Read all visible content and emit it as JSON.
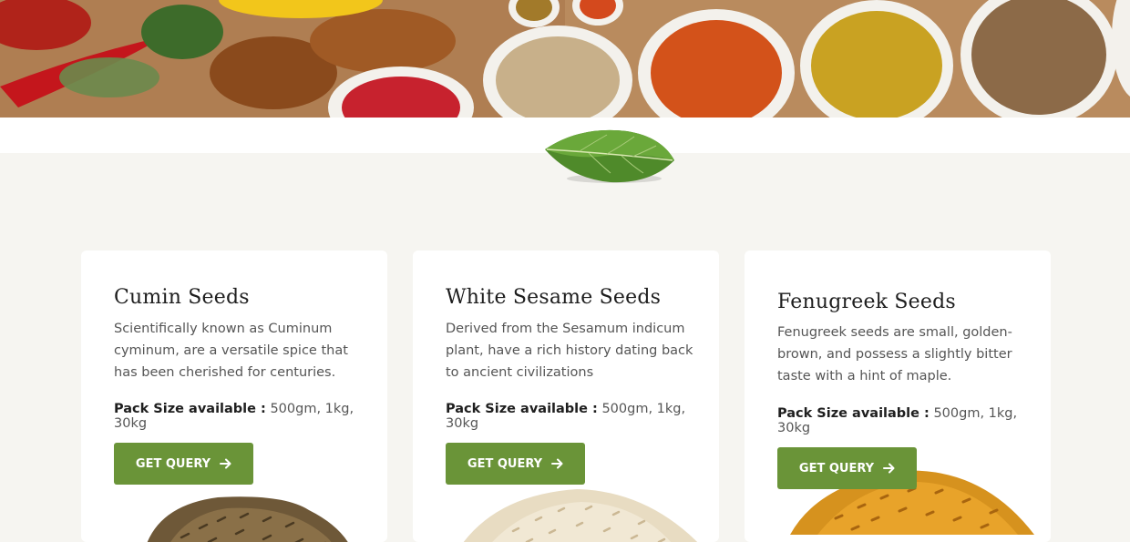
{
  "products": [
    {
      "title": "Cumin Seeds",
      "description": "Scientifically known as Cuminum cyminum, are a versatile spice that has been cherished for centuries.",
      "pack_label": "Pack Size available :",
      "pack_value": "500gm, 1kg, 30kg",
      "button_label": "GET QUERY"
    },
    {
      "title": "White Sesame Seeds",
      "description": "Derived from the Sesamum indicum plant, have a rich history dating back to ancient civilizations",
      "pack_label": "Pack Size available :",
      "pack_value": "500gm, 1kg, 30kg",
      "button_label": "GET QUERY"
    },
    {
      "title": "Fenugreek Seeds",
      "description": "Fenugreek seeds are small, golden-brown, and possess a slightly bitter taste with a hint of maple.",
      "pack_label": "Pack Size available :",
      "pack_value": "500gm, 1kg, 30kg",
      "button_label": "GET QUERY"
    }
  ],
  "icons": {
    "button_arrow": "arrow-right-icon",
    "divider": "basil-leaf-icon"
  },
  "colors": {
    "page_background": "#f6f5f1",
    "card_background": "#ffffff",
    "button": "#6a9438",
    "heading": "#1e1e1e",
    "body_text": "#555555"
  }
}
